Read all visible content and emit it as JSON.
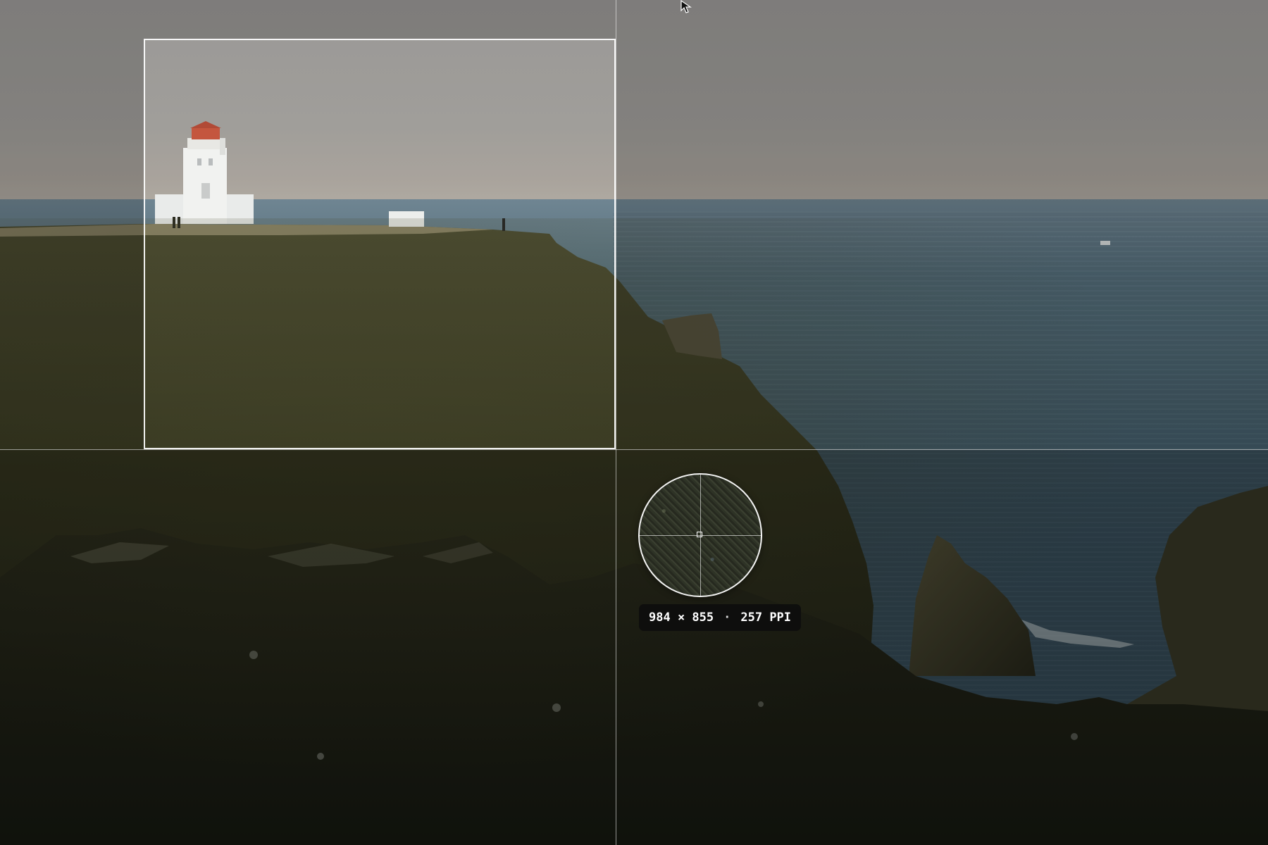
{
  "readout": {
    "dimensions": "984 × 855",
    "separator": "·",
    "resolution": "257 PPI"
  },
  "icons": {
    "cursor": "arrow-cursor-icon",
    "loupe_center": "crosshair-square-icon"
  },
  "colors": {
    "selection_border": "#ffffff",
    "readout_background": "#0c0c0c",
    "lighthouse_roof": "#c4563e"
  }
}
